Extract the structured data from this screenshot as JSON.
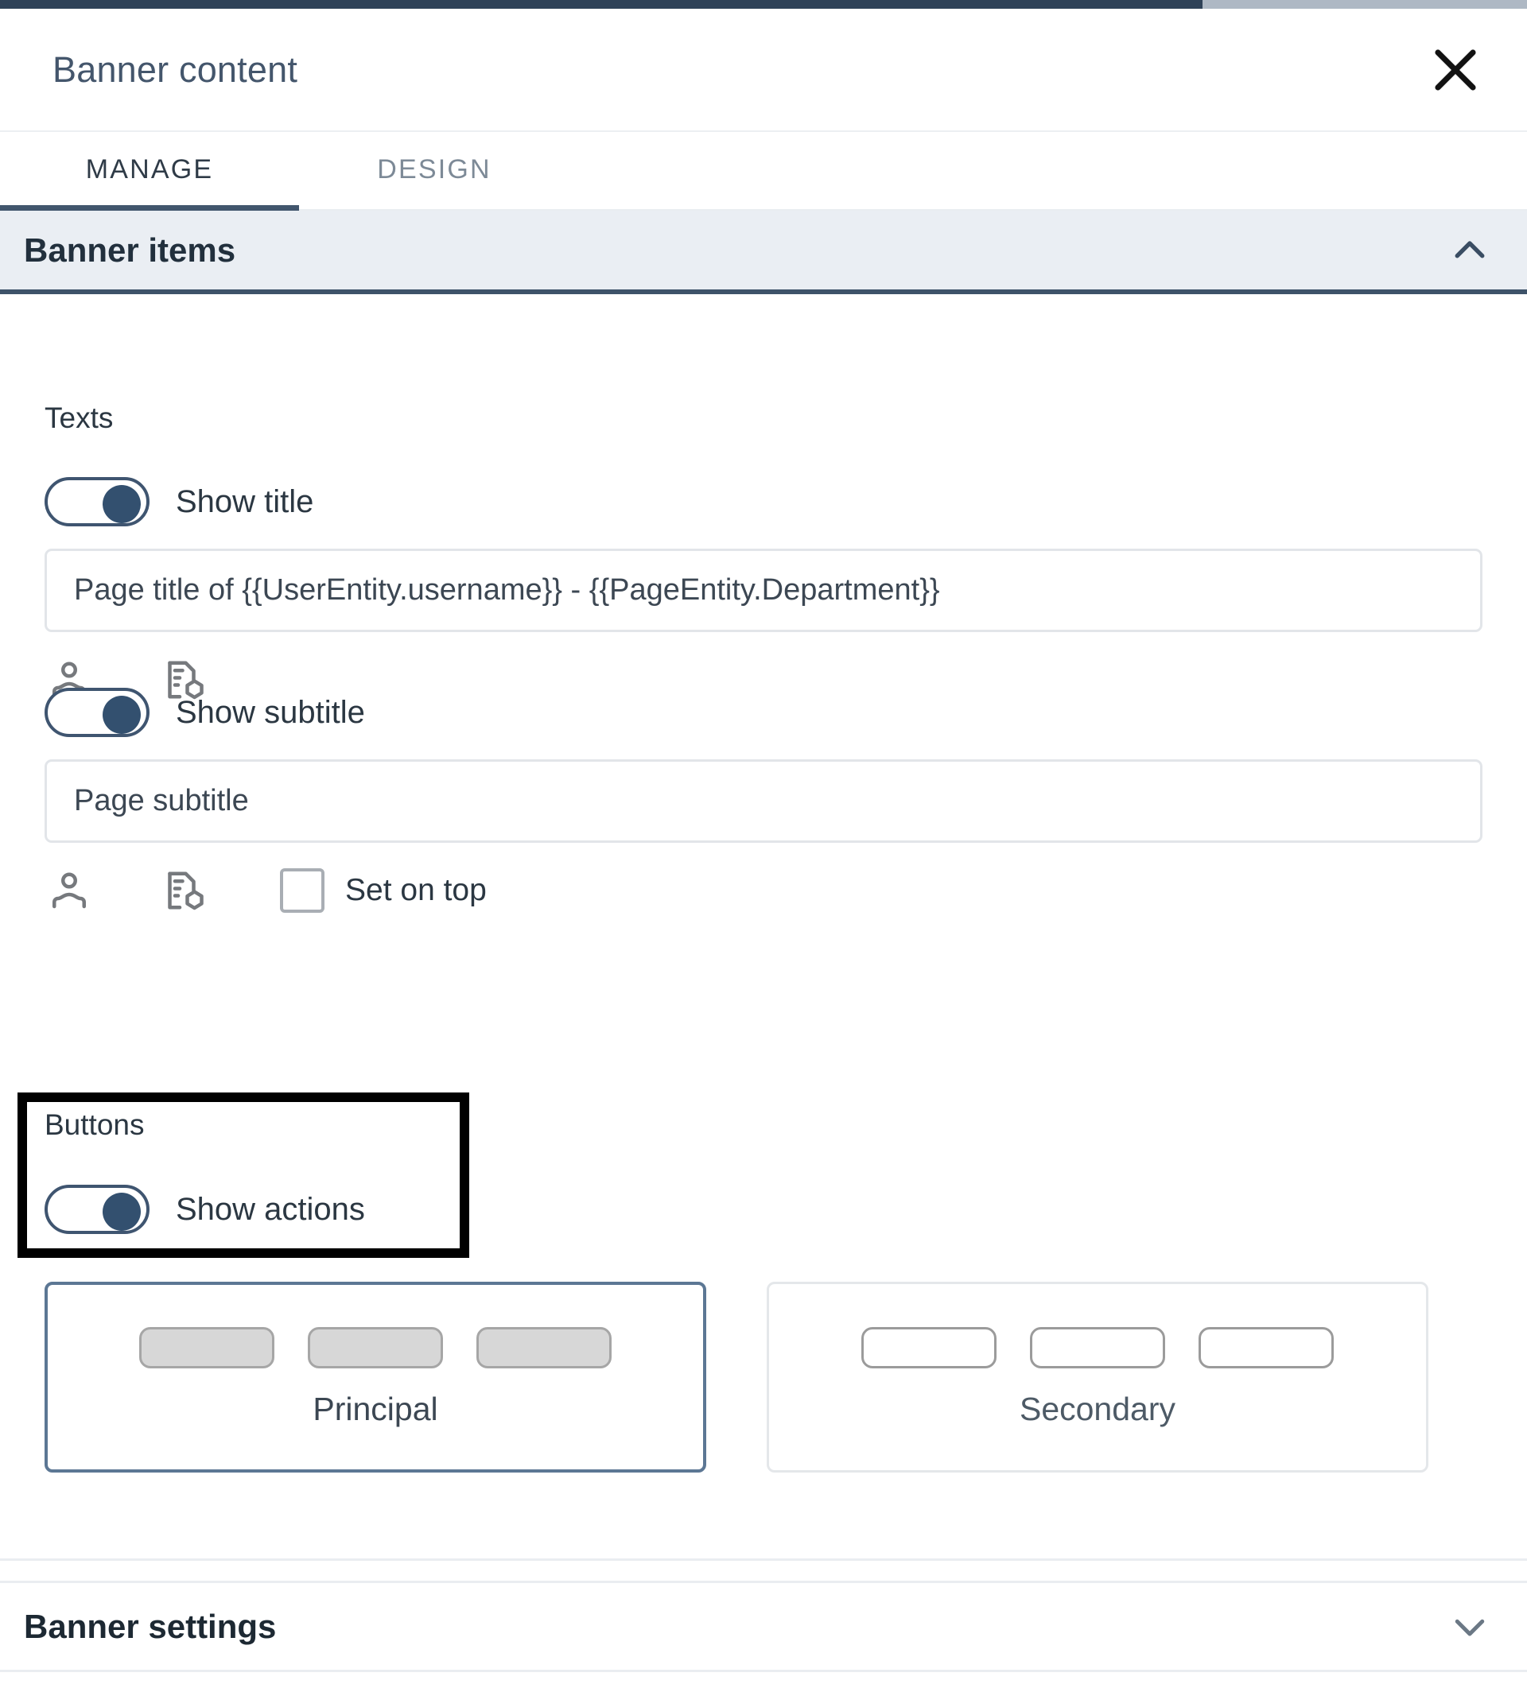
{
  "window": {
    "accent_dark": "#2f4258",
    "accent_light": "#aeb8c4"
  },
  "header": {
    "title": "Banner content",
    "close_icon": "close-icon"
  },
  "tabs": [
    {
      "label": "MANAGE",
      "active": true
    },
    {
      "label": "DESIGN",
      "active": false
    }
  ],
  "sections": {
    "banner_items": {
      "label": "Banner items",
      "expanded": true,
      "chevron_icon": "chevron-up-icon"
    },
    "banner_settings": {
      "label": "Banner settings",
      "expanded": false,
      "chevron_icon": "chevron-down-icon"
    }
  },
  "texts": {
    "group_label": "Texts",
    "show_title": {
      "label": "Show title",
      "on": true
    },
    "title_input": {
      "value": "Page title of {{UserEntity.username}} - {{PageEntity.Department}}",
      "placeholder": "Page title"
    },
    "title_icons": [
      {
        "name": "user-entity-icon"
      },
      {
        "name": "page-entity-icon"
      }
    ],
    "show_subtitle": {
      "label": "Show subtitle",
      "on": true
    },
    "subtitle_input": {
      "value": "Page subtitle",
      "placeholder": "Page subtitle"
    },
    "subtitle_icons": [
      {
        "name": "user-entity-icon"
      },
      {
        "name": "page-entity-icon"
      }
    ],
    "set_on_top": {
      "label": "Set on top",
      "checked": false
    }
  },
  "buttons": {
    "group_label": "Buttons",
    "show_actions": {
      "label": "Show actions",
      "on": true
    },
    "variants": [
      {
        "label": "Principal",
        "selected": true,
        "style": "filled",
        "count": 3
      },
      {
        "label": "Secondary",
        "selected": false,
        "style": "outlined",
        "count": 3
      }
    ]
  },
  "highlight": {
    "color": "#000000",
    "target": "buttons-group"
  }
}
